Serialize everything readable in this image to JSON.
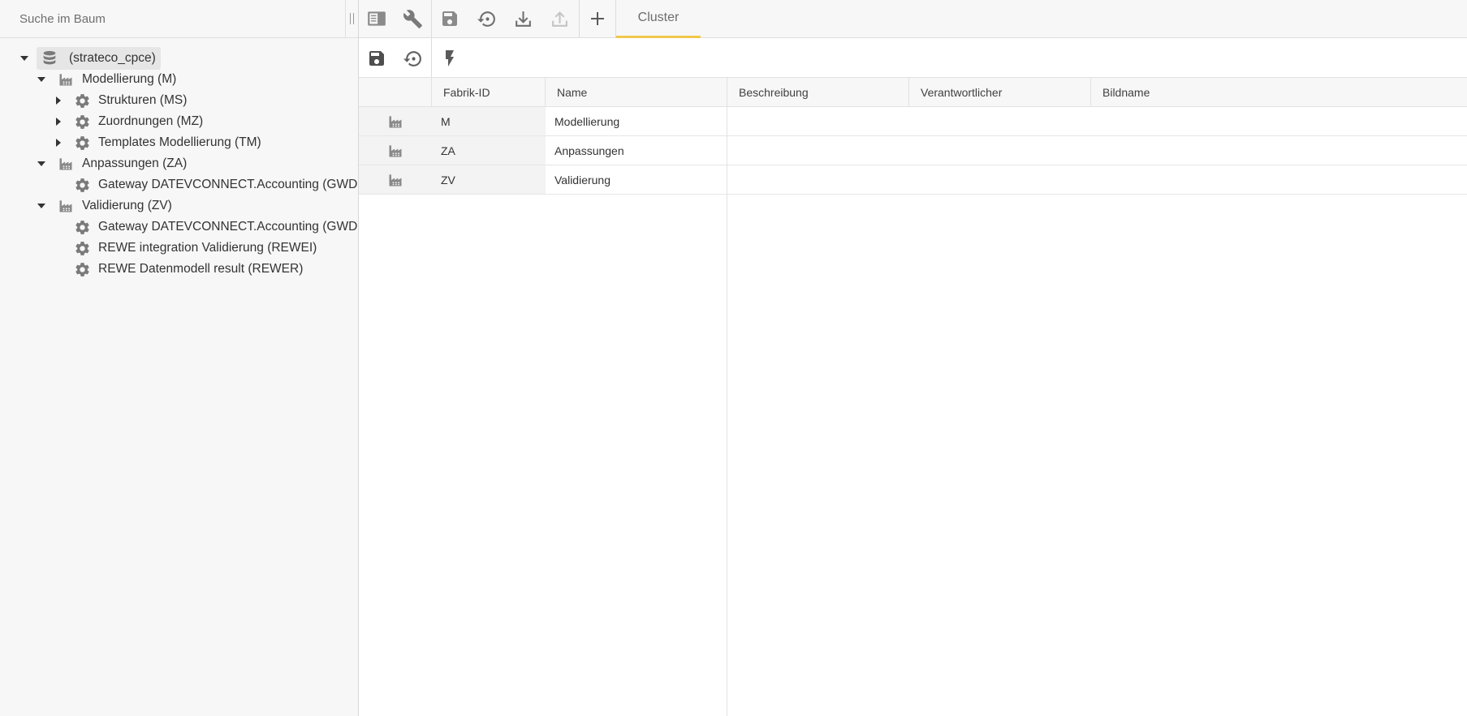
{
  "search": {
    "placeholder": "Suche im Baum"
  },
  "tab": {
    "label": "Cluster"
  },
  "colors": {
    "accent": "#f2c84a",
    "icon": "#7a7a7a",
    "icon_disabled": "#c4c4c4",
    "panel_bg": "#f7f7f7"
  },
  "tree": {
    "root": {
      "label": "(strateco_cpce)",
      "icon": "database-icon",
      "expanded": true
    },
    "nodes": [
      {
        "label": "Modellierung (M)",
        "icon": "factory-icon",
        "level": 1,
        "expanded": true
      },
      {
        "label": "Strukturen (MS)",
        "icon": "gear-icon",
        "level": 2,
        "expanded": false
      },
      {
        "label": "Zuordnungen (MZ)",
        "icon": "gear-icon",
        "level": 2,
        "expanded": false
      },
      {
        "label": "Templates Modellierung (TM)",
        "icon": "gear-icon",
        "level": 2,
        "expanded": false
      },
      {
        "label": "Anpassungen (ZA)",
        "icon": "factory-icon",
        "level": 1,
        "expanded": true
      },
      {
        "label": "Gateway DATEVCONNECT.Accounting (GWDC",
        "icon": "gear-icon",
        "level": 2
      },
      {
        "label": "Validierung (ZV)",
        "icon": "factory-icon",
        "level": 1,
        "expanded": true
      },
      {
        "label": "Gateway DATEVCONNECT.Accounting (GWDC",
        "icon": "gear-icon",
        "level": 2
      },
      {
        "label": "REWE integration Validierung (REWEI)",
        "icon": "gear-icon",
        "level": 2
      },
      {
        "label": "REWE Datenmodell result (REWER)",
        "icon": "gear-icon",
        "level": 2
      }
    ]
  },
  "toolbar": {
    "buttons": [
      {
        "icon": "sidebar-toggle-icon",
        "enabled": true
      },
      {
        "icon": "wrench-icon",
        "enabled": true
      },
      {
        "icon": "save-icon",
        "enabled": true
      },
      {
        "icon": "restore-icon",
        "enabled": true
      },
      {
        "icon": "download-icon",
        "enabled": true
      },
      {
        "icon": "upload-icon",
        "enabled": false
      },
      {
        "icon": "plus-icon",
        "enabled": true
      }
    ]
  },
  "subtoolbar": {
    "buttons": [
      {
        "icon": "save-icon"
      },
      {
        "icon": "restore-icon"
      },
      {
        "icon": "lightning-icon"
      }
    ]
  },
  "grid": {
    "columns": [
      "",
      "Fabrik-ID",
      "Name",
      "Beschreibung",
      "Verantwortlicher",
      "Bildname"
    ],
    "rows": [
      {
        "icon": "factory-icon",
        "id": "M",
        "name": "Modellierung",
        "beschreibung": "",
        "verantwortlicher": "",
        "bildname": ""
      },
      {
        "icon": "factory-icon",
        "id": "ZA",
        "name": "Anpassungen",
        "beschreibung": "",
        "verantwortlicher": "",
        "bildname": ""
      },
      {
        "icon": "factory-icon",
        "id": "ZV",
        "name": "Validierung",
        "beschreibung": "",
        "verantwortlicher": "",
        "bildname": ""
      }
    ]
  }
}
